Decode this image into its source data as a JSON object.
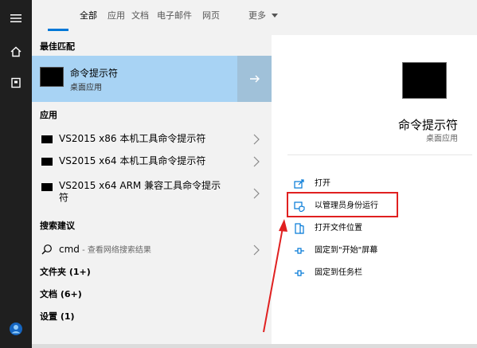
{
  "tabs": [
    {
      "label": "全部",
      "active": true
    },
    {
      "label": "应用",
      "active": false
    },
    {
      "label": "文档",
      "active": false
    },
    {
      "label": "电子邮件",
      "active": false
    },
    {
      "label": "网页",
      "active": false
    },
    {
      "label": "更多",
      "active": false
    }
  ],
  "rail": {
    "icons": [
      "hamburger-icon",
      "home-icon",
      "document-icon",
      "avatar-icon"
    ]
  },
  "results": {
    "best_match_header": "最佳匹配",
    "best_match": {
      "title": "命令提示符",
      "subtitle": "桌面应用"
    },
    "apps_header": "应用",
    "apps": [
      {
        "label": "VS2015 x86 本机工具命令提示符"
      },
      {
        "label": "VS2015 x64 本机工具命令提示符"
      },
      {
        "label": "VS2015 x64 ARM 兼容工具命令提示符"
      }
    ],
    "suggest_header": "搜索建议",
    "suggest": {
      "query": "cmd",
      "hint": " - 查看网络搜索结果"
    },
    "folders": "文件夹 (1+)",
    "docs": "文档 (6+)",
    "settings": "设置 (1)"
  },
  "preview": {
    "title": "命令提示符",
    "subtitle": "桌面应用",
    "actions": [
      {
        "label": "打开",
        "icon": "open-icon"
      },
      {
        "label": "以管理员身份运行",
        "icon": "shield-icon"
      },
      {
        "label": "打开文件位置",
        "icon": "folder-location-icon"
      },
      {
        "label": "固定到\"开始\"屏幕",
        "icon": "pin-icon"
      },
      {
        "label": "固定到任务栏",
        "icon": "pin-icon"
      }
    ]
  },
  "colors": {
    "accent": "#0078d7",
    "highlight": "#a8d3f4",
    "annotation": "#e02020"
  }
}
